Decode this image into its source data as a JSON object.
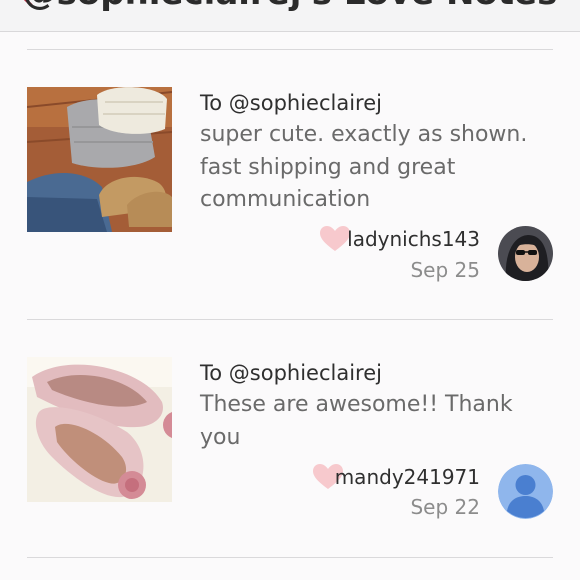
{
  "header": {
    "title": "@sophieclairej's Love Notes",
    "back_icon": "chevron-left-icon",
    "accent_color": "#b6283e"
  },
  "notes": [
    {
      "to": "To @sophieclairej",
      "text": "super cute. exactly as shown. fast shipping and great communication",
      "username": "ladynichs143",
      "date": "Sep 25",
      "heart_icon": "heart-icon",
      "image": "clothing-and-shoes-photo",
      "avatar": "user-photo"
    },
    {
      "to": "To @sophieclairej",
      "text": "These are awesome!! Thank you",
      "username": "mandy241971",
      "date": "Sep 22",
      "heart_icon": "heart-icon",
      "image": "pink-flats-photo",
      "avatar": "default-user-icon"
    }
  ],
  "colors": {
    "heart": "#f7c9cd",
    "default_avatar_bg": "#8fb6ec",
    "default_avatar_fg": "#4a7fd0"
  }
}
